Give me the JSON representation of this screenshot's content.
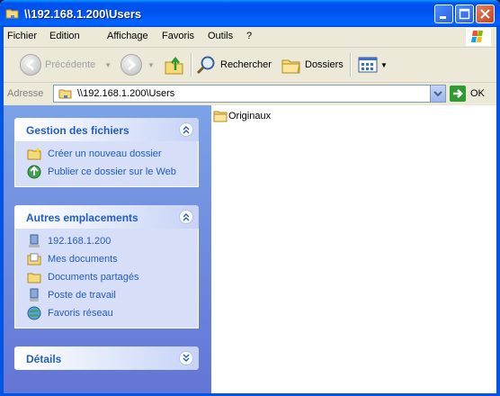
{
  "window": {
    "title": "\\\\192.168.1.200\\Users"
  },
  "menu": [
    {
      "label": "Fichier"
    },
    {
      "label": "Edition"
    },
    {
      "label": "Affichage"
    },
    {
      "label": "Favoris"
    },
    {
      "label": "Outils"
    },
    {
      "label": "?"
    }
  ],
  "toolbar": {
    "back_label": "Précédente",
    "search_label": "Rechercher",
    "folders_label": "Dossiers"
  },
  "address": {
    "label": "Adresse",
    "value": "\\\\192.168.1.200\\Users",
    "go_label": "OK"
  },
  "panels": {
    "file_tasks": {
      "title": "Gestion des fichiers",
      "links": [
        {
          "label": "Créer un nouveau dossier",
          "icon": "new-folder-icon"
        },
        {
          "label": "Publier ce dossier sur le Web",
          "icon": "publish-web-icon"
        }
      ]
    },
    "other_places": {
      "title": "Autres emplacements",
      "links": [
        {
          "label": "192.168.1.200",
          "icon": "network-computer-icon"
        },
        {
          "label": "Mes documents",
          "icon": "my-documents-icon"
        },
        {
          "label": "Documents partagés",
          "icon": "shared-folder-icon"
        },
        {
          "label": "Poste de travail",
          "icon": "my-computer-icon"
        },
        {
          "label": "Favoris réseau",
          "icon": "network-places-icon"
        }
      ]
    },
    "details": {
      "title": "Détails"
    }
  },
  "files": [
    {
      "name": "Originaux",
      "icon": "folder-icon"
    }
  ],
  "colors": {
    "titlebar": "#0053ee",
    "sidebar": "#6f8fe0",
    "link": "#215dc6",
    "panel_body": "#d6dff7"
  }
}
